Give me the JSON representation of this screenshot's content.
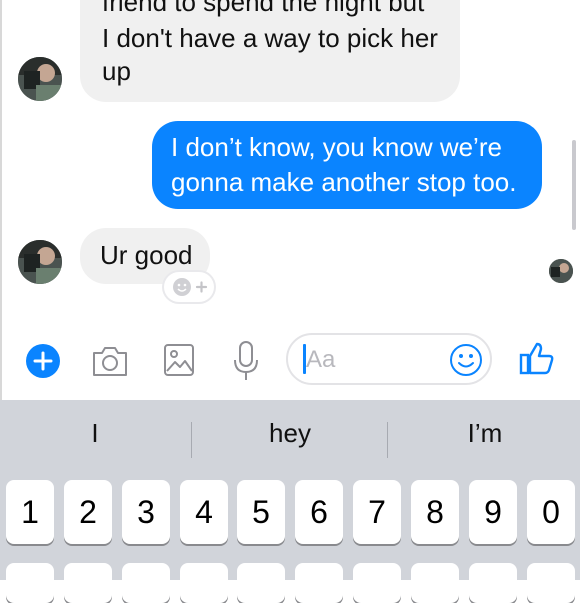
{
  "conversation": {
    "messages": [
      {
        "sender": "contact",
        "lines": [
          "friend to spend the night but",
          "I don't have a way to pick her",
          "up"
        ]
      },
      {
        "sender": "me",
        "lines": [
          "I don’t know, you know we’re",
          "gonna make another stop too."
        ]
      },
      {
        "sender": "contact",
        "lines": [
          "Ur good"
        ]
      }
    ]
  },
  "composer": {
    "placeholder": "Aa",
    "icons": [
      "plus-icon",
      "camera-icon",
      "gallery-icon",
      "microphone-icon",
      "emoji-icon",
      "thumbs-up-icon"
    ],
    "accent": "#0a84ff"
  },
  "keyboard": {
    "suggestions": [
      "I",
      "hey",
      "I’m"
    ],
    "number_row": [
      "1",
      "2",
      "3",
      "4",
      "5",
      "6",
      "7",
      "8",
      "9",
      "0"
    ],
    "background": "#d1d4da"
  }
}
